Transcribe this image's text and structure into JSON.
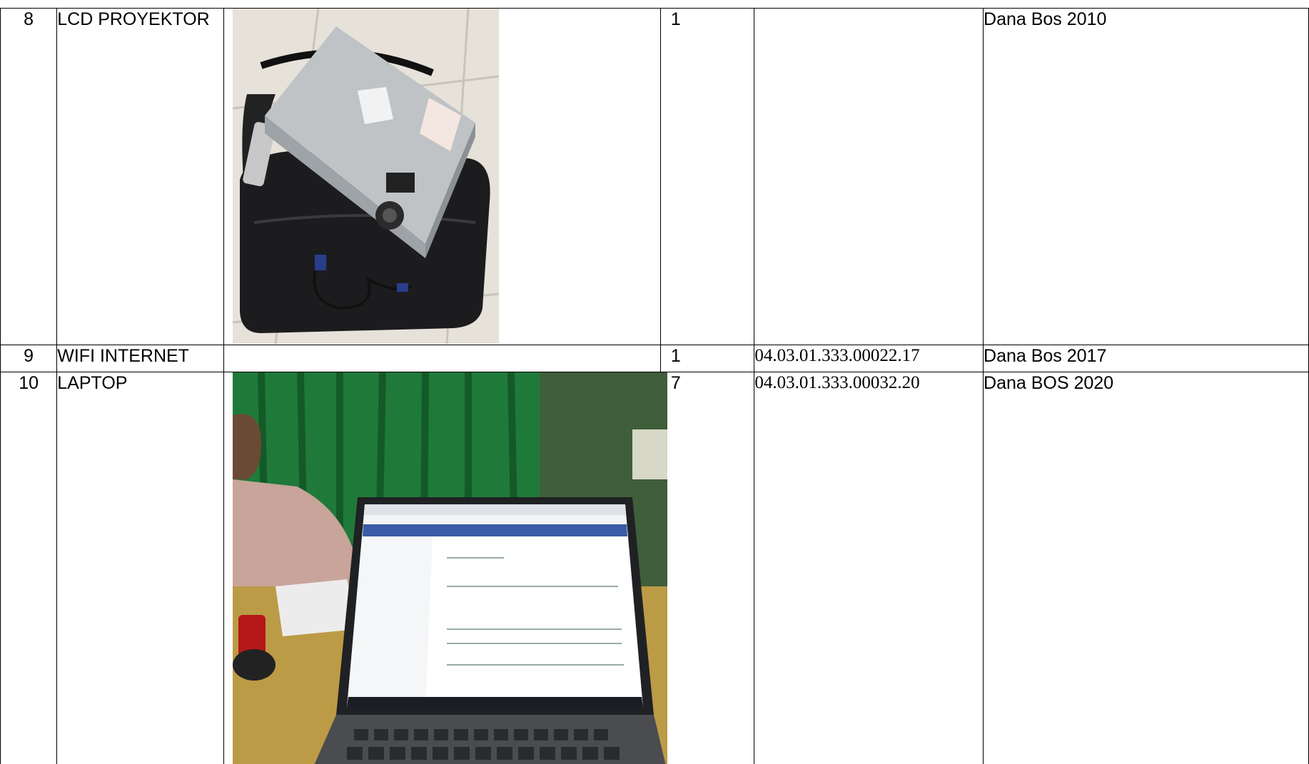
{
  "rows": [
    {
      "no": "8",
      "name": "LCD PROYEKTOR",
      "qty": "1",
      "code": "",
      "source": "Dana Bos 2010",
      "photo": "projector-photo"
    },
    {
      "no": "9",
      "name": "WIFI INTERNET",
      "qty": "1",
      "code": "04.03.01.333.00022.17",
      "source": "Dana Bos 2017",
      "photo": ""
    },
    {
      "no": "10",
      "name": "LAPTOP",
      "qty": "7",
      "code": "04.03.01.333.00032.20",
      "source": "Dana BOS 2020",
      "photo": "laptop-photo"
    }
  ]
}
